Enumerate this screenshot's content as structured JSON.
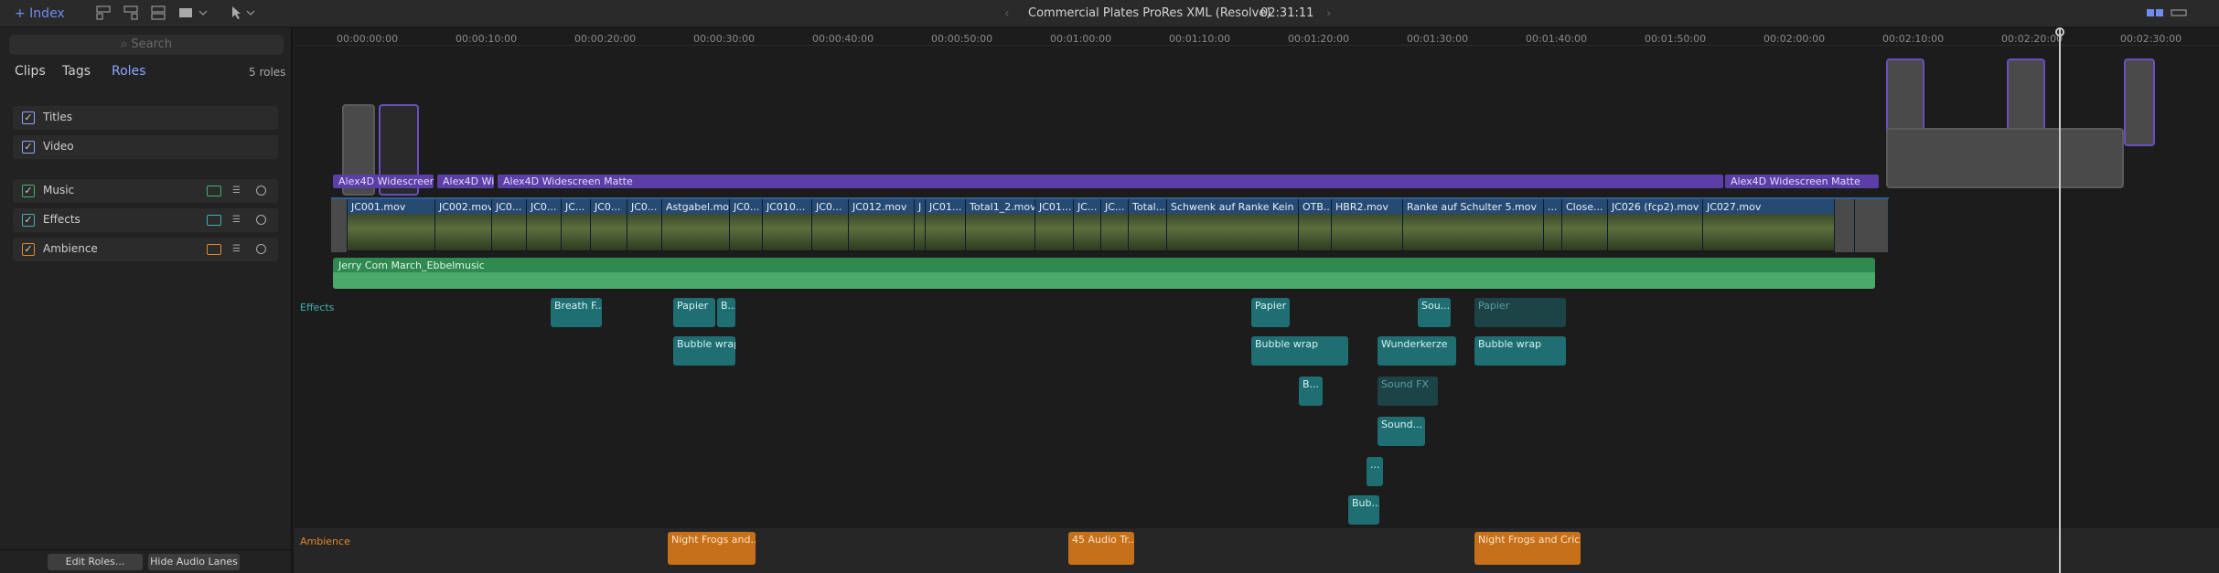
{
  "toolbar": {
    "index_label": "+ Index",
    "project_title": "Commercial Plates ProRes XML (Resolve)",
    "timecode": "02:31:11",
    "back_arrow": "‹",
    "forward_arrow": "›"
  },
  "sidebar": {
    "search_placeholder": "Search",
    "tabs": [
      "Clips",
      "Tags",
      "Roles"
    ],
    "active_tab": "Roles",
    "roles_count": "5 roles",
    "roles": [
      {
        "label": "Titles",
        "checked": true
      },
      {
        "label": "Video",
        "checked": true
      },
      {
        "label": "Music",
        "checked": true
      },
      {
        "label": "Effects",
        "checked": true
      },
      {
        "label": "Ambience",
        "checked": true
      }
    ],
    "edit_roles_label": "Edit Roles...",
    "hide_audio_label": "Hide Audio Lanes"
  },
  "ruler": [
    "00:00:00:00",
    "00:00:10:00",
    "00:00:20:00",
    "00:00:30:00",
    "00:00:40:00",
    "00:00:50:00",
    "00:01:00:00",
    "00:01:10:00",
    "00:01:20:00",
    "00:01:30:00",
    "00:01:40:00",
    "00:01:50:00",
    "00:02:00:00",
    "00:02:10:00",
    "00:02:20:00",
    "00:02:30:00"
  ],
  "title_bands": [
    "Alex4D Widescreen...",
    "Alex4D Wi...",
    "Alex4D Widescreen Matte",
    "Alex4D Widescreen Matte"
  ],
  "video_clips": [
    "JC001.mov",
    "JC002.mov",
    "JC0...",
    "JC0...",
    "JC...",
    "JC0...",
    "JC0...",
    "Astgabel.mov",
    "JC0...",
    "JC010...",
    "JC0...",
    "JC012.mov",
    "J",
    "JC01...",
    "Total1_2.mov",
    "JC01...",
    "JC...",
    "JC...",
    "Total...",
    "Schwenk auf Ranke Kein Ra...",
    "OTB...",
    "HBR2.mov",
    "Ranke auf Schulter 5.mov",
    "...",
    "Close...",
    "JC026 (fcp2).mov",
    "JC027.mov"
  ],
  "music": {
    "lane_label": "Jerry Com March_Ebbelmusic"
  },
  "effects": {
    "lane_label": "Effects",
    "clips": [
      "Breath F...",
      "Papier",
      "B...",
      "Bubble wrap",
      "Papier",
      "Bubble wrap",
      "B...",
      "Sou...",
      "Wunderkerze",
      "Papier",
      "Bubble wrap",
      "Sound FX",
      "Sound...",
      "...",
      "Bub..."
    ]
  },
  "ambience": {
    "lane_label": "Ambience",
    "clips": [
      "Night Frogs and...",
      "45 Audio Tr...",
      "Night Frogs and Cric..."
    ]
  },
  "colors": {
    "accent": "#6f8cf0",
    "titles": "#5b3ea6",
    "video": "#274a73",
    "music": "#2f8a4f",
    "effects": "#1e6e72",
    "ambience": "#c7701a"
  }
}
